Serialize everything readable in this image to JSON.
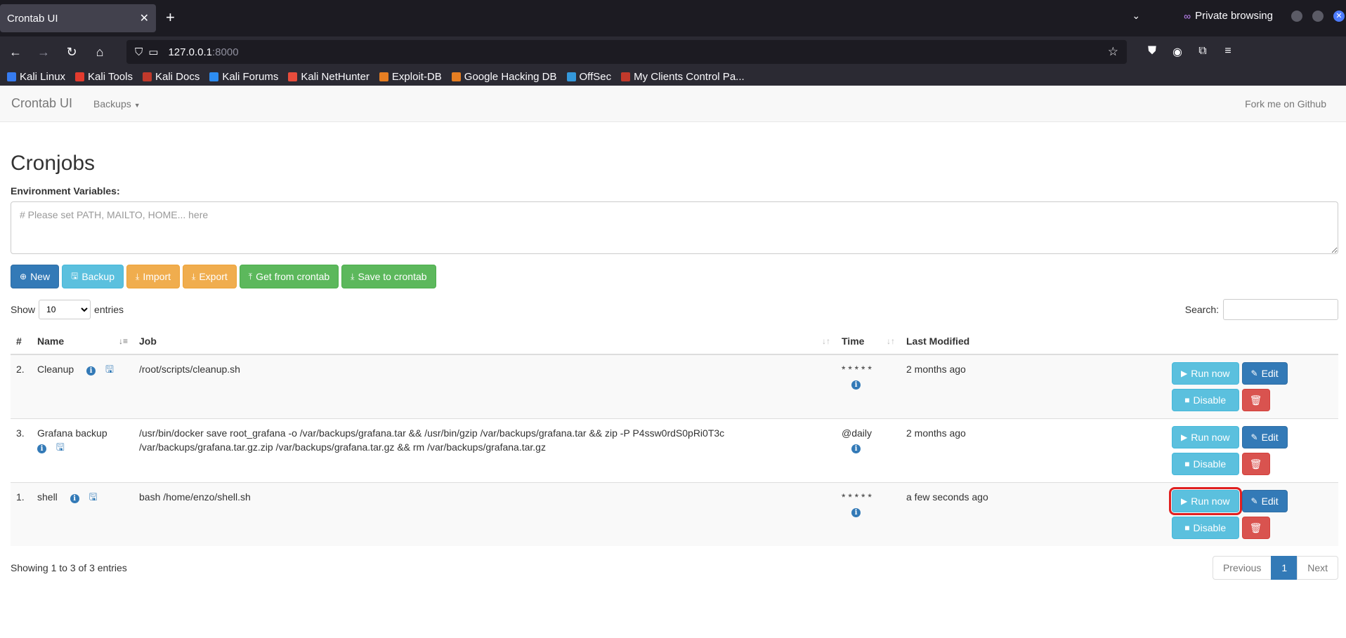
{
  "browser": {
    "tab_title": "Crontab UI",
    "private_label": "Private browsing",
    "url_host": "127.0.0.1",
    "url_port": ":8000",
    "bookmarks": [
      {
        "label": "Kali Linux",
        "color": "#367bf0"
      },
      {
        "label": "Kali Tools",
        "color": "#e33b2e"
      },
      {
        "label": "Kali Docs",
        "color": "#c0392b"
      },
      {
        "label": "Kali Forums",
        "color": "#2d8cf0"
      },
      {
        "label": "Kali NetHunter",
        "color": "#e74c3c"
      },
      {
        "label": "Exploit-DB",
        "color": "#e67e22"
      },
      {
        "label": "Google Hacking DB",
        "color": "#e67e22"
      },
      {
        "label": "OffSec",
        "color": "#3498db"
      },
      {
        "label": "My Clients Control Pa...",
        "color": "#c0392b"
      }
    ]
  },
  "app": {
    "brand": "Crontab UI",
    "backups_menu": "Backups",
    "fork_link": "Fork me on Github",
    "page_title": "Cronjobs",
    "env_label": "Environment Variables:",
    "env_placeholder": "# Please set PATH, MAILTO, HOME... here",
    "toolbar": {
      "new": "New",
      "backup": "Backup",
      "import": "Import",
      "export": "Export",
      "get_from_crontab": "Get from crontab",
      "save_to_crontab": "Save to crontab"
    },
    "show_label": "Show",
    "entries_value": "10",
    "entries_label": "entries",
    "search_label": "Search:",
    "columns": [
      "#",
      "Name",
      "Job",
      "Time",
      "Last Modified"
    ],
    "jobs": [
      {
        "num": "2.",
        "name": "Cleanup",
        "job": "/root/scripts/cleanup.sh",
        "time": "* * * * *",
        "modified": "2 months ago"
      },
      {
        "num": "3.",
        "name": "Grafana backup",
        "job": "/usr/bin/docker save root_grafana -o /var/backups/grafana.tar && /usr/bin/gzip /var/backups/grafana.tar && zip -P P4ssw0rdS0pRi0T3c /var/backups/grafana.tar.gz.zip /var/backups/grafana.tar.gz && rm /var/backups/grafana.tar.gz",
        "time": "@daily",
        "modified": "2 months ago"
      },
      {
        "num": "1.",
        "name": "shell",
        "job": "bash /home/enzo/shell.sh",
        "time": "* * * * *",
        "modified": "a few seconds ago"
      }
    ],
    "row_actions": {
      "run": "Run now",
      "edit": "Edit",
      "disable": "Disable"
    },
    "footer_info": "Showing 1 to 3 of 3 entries",
    "pagination": {
      "previous": "Previous",
      "current": "1",
      "next": "Next"
    }
  }
}
